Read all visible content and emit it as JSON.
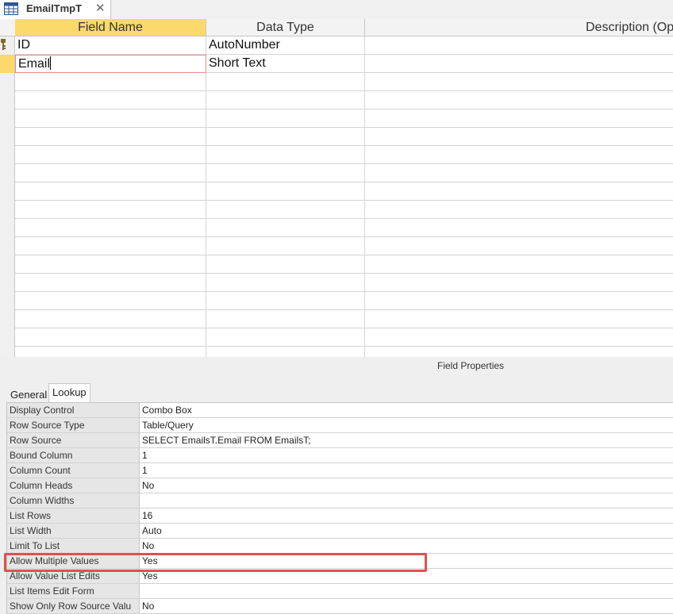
{
  "document_tab": {
    "title": "EmailTmpT",
    "icon": "table-icon",
    "close_icon": "close-icon",
    "close_glyph": "✕"
  },
  "design_grid": {
    "columns": [
      "Field Name",
      "Data Type",
      "Description (Op"
    ],
    "rows": [
      {
        "field_name": "ID",
        "data_type": "AutoNumber",
        "description": "",
        "primary_key": true
      },
      {
        "field_name": "Email",
        "data_type": "Short Text",
        "description": "",
        "current": true
      }
    ]
  },
  "properties": {
    "title": "Field Properties",
    "tabs": [
      "General",
      "Lookup"
    ],
    "active_tab": "Lookup",
    "rows": [
      {
        "name": "Display Control",
        "value": "Combo Box"
      },
      {
        "name": "Row Source Type",
        "value": "Table/Query"
      },
      {
        "name": "Row Source",
        "value": "SELECT EmailsT.Email FROM EmailsT;"
      },
      {
        "name": "Bound Column",
        "value": "1"
      },
      {
        "name": "Column Count",
        "value": "1"
      },
      {
        "name": "Column Heads",
        "value": "No"
      },
      {
        "name": "Column Widths",
        "value": ""
      },
      {
        "name": "List Rows",
        "value": "16"
      },
      {
        "name": "List Width",
        "value": "Auto"
      },
      {
        "name": "Limit To List",
        "value": "No"
      },
      {
        "name": "Allow Multiple Values",
        "value": "Yes"
      },
      {
        "name": "Allow Value List Edits",
        "value": "Yes"
      },
      {
        "name": "List Items Edit Form",
        "value": ""
      },
      {
        "name": "Show Only Row Source Valu",
        "value": "No"
      }
    ]
  },
  "colors": {
    "active_header": "#fbd96b",
    "highlight_box": "#e05050",
    "editing_border": "#e88a8a"
  }
}
